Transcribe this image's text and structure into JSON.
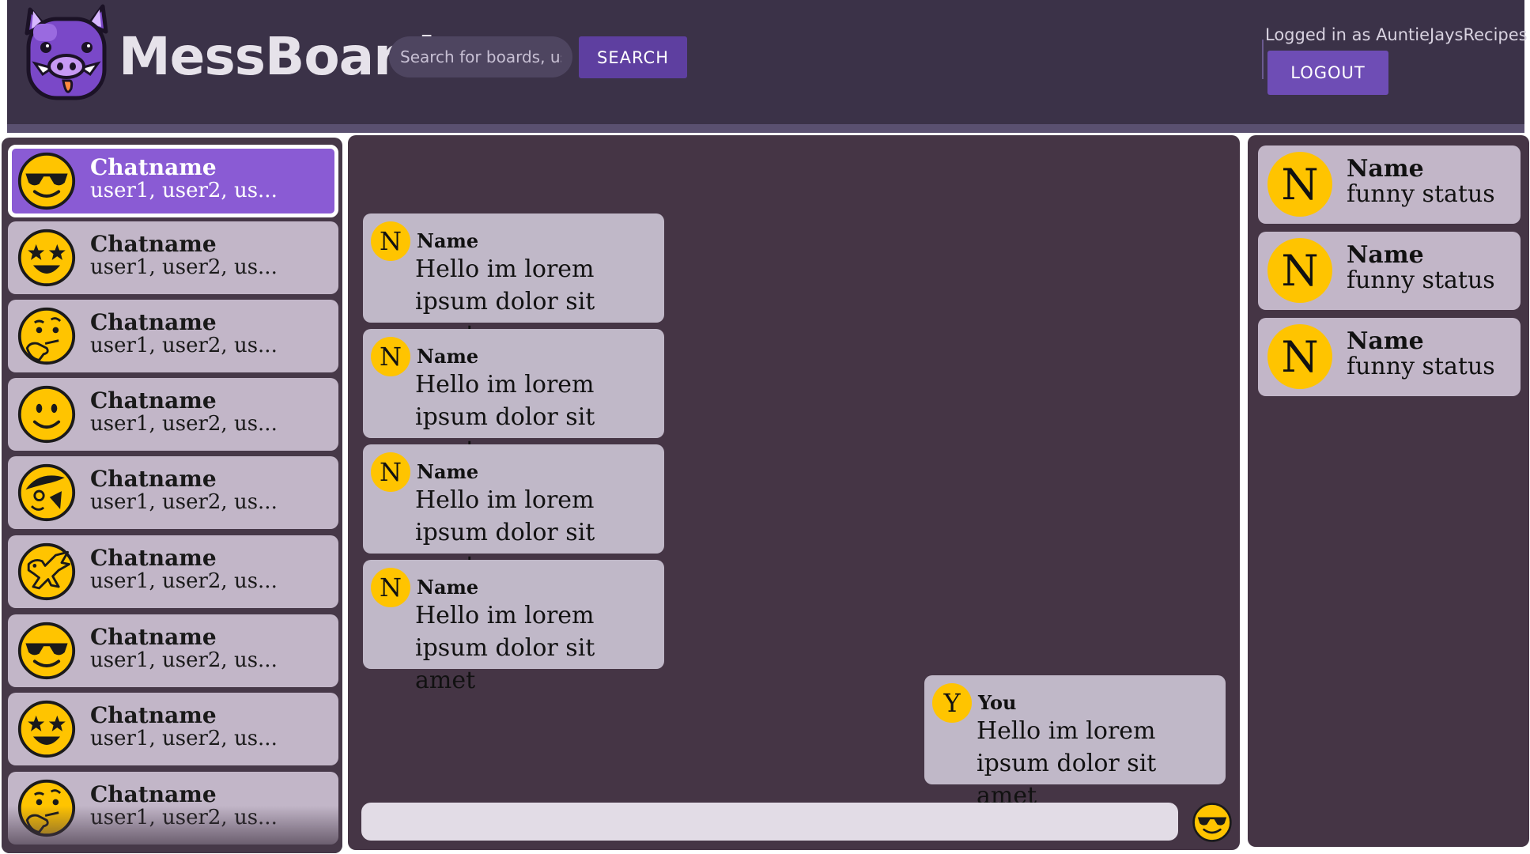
{
  "app": {
    "brand": "MessBoard",
    "search_placeholder": "Search for boards, users",
    "search_button": "SEARCH",
    "logged_in_text": "Logged in as AuntieJaysRecipes",
    "logout_button": "LOGOUT"
  },
  "sidebar": {
    "chats": [
      {
        "title": "Chatname",
        "members": "user1, user2, us...",
        "icon": "sunglasses-face-icon",
        "selected": true
      },
      {
        "title": "Chatname",
        "members": "user1, user2, us...",
        "icon": "star-struck-face-icon"
      },
      {
        "title": "Chatname",
        "members": "user1, user2, us...",
        "icon": "thinking-face-icon"
      },
      {
        "title": "Chatname",
        "members": "user1, user2, us...",
        "icon": "slightly-smiling-face-icon"
      },
      {
        "title": "Chatname",
        "members": "user1, user2, us...",
        "icon": "strange-face-icon"
      },
      {
        "title": "Chatname",
        "members": "user1, user2, us...",
        "icon": "eagle-icon"
      },
      {
        "title": "Chatname",
        "members": "user1, user2, us...",
        "icon": "sunglasses-face-icon"
      },
      {
        "title": "Chatname",
        "members": "user1, user2, us...",
        "icon": "star-struck-face-icon"
      },
      {
        "title": "Chatname",
        "members": "user1, user2, us...",
        "icon": "thinking-face-icon"
      }
    ]
  },
  "messages": [
    {
      "initial": "N",
      "name": "Name",
      "text": "Hello im lorem ipsum dolor sit amet",
      "side": "left"
    },
    {
      "initial": "N",
      "name": "Name",
      "text": "Hello im lorem ipsum dolor sit amet",
      "side": "left"
    },
    {
      "initial": "N",
      "name": "Name",
      "text": "Hello im lorem ipsum dolor sit amet",
      "side": "left"
    },
    {
      "initial": "N",
      "name": "Name",
      "text": "Hello im lorem ipsum dolor sit amet",
      "side": "left"
    },
    {
      "initial": "Y",
      "name": "You",
      "text": "Hello im lorem ipsum dolor sit amet",
      "side": "right"
    }
  ],
  "composer": {
    "emoji_icon": "sunglasses-face-icon"
  },
  "members": [
    {
      "initial": "N",
      "name": "Name",
      "status": "funny status"
    },
    {
      "initial": "N",
      "name": "Name",
      "status": "funny status"
    },
    {
      "initial": "N",
      "name": "Name",
      "status": "funny status"
    }
  ],
  "colors": {
    "header_bg": "#3b3248",
    "panel_bg": "#453545",
    "accent": "#6e4db5",
    "selected_chat": "#8a5bd4",
    "avatar_yellow": "#ffc400",
    "bubble": "#c0b8c8"
  }
}
